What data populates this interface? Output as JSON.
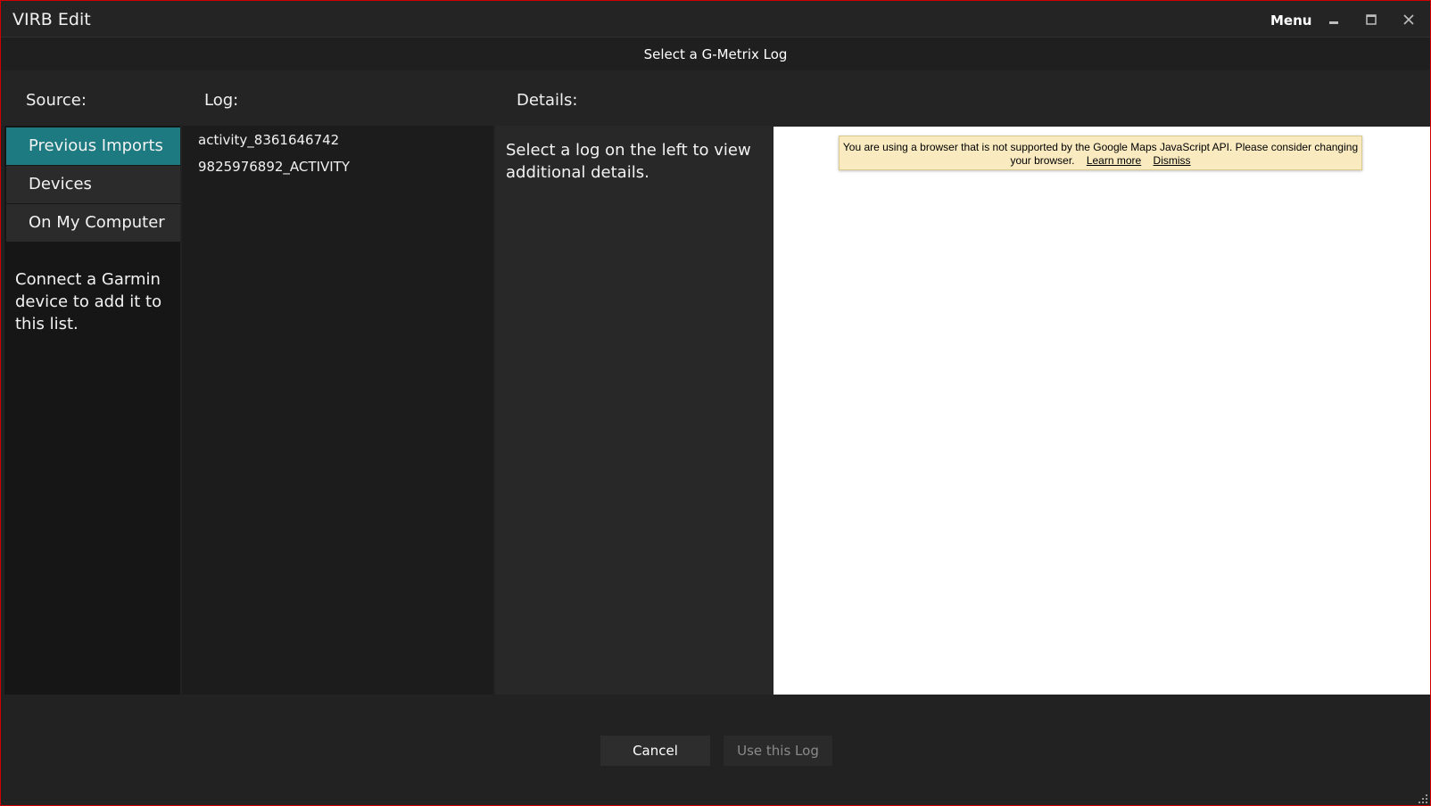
{
  "app": {
    "title": "VIRB Edit",
    "menu_label": "Menu"
  },
  "window_controls": {
    "minimize_icon": "minimize-icon",
    "maximize_icon": "maximize-icon",
    "close_icon": "close-icon"
  },
  "dialog": {
    "title": "Select a G-Metrix Log"
  },
  "columns": {
    "source": "Source:",
    "log": "Log:",
    "details": "Details:"
  },
  "sources": {
    "items": [
      {
        "label": "Previous Imports",
        "selected": true
      },
      {
        "label": "Devices",
        "selected": false
      },
      {
        "label": "On My Computer",
        "selected": false
      }
    ],
    "hint": "Connect a Garmin device to add it to this list."
  },
  "logs": {
    "items": [
      "activity_8361646742",
      "9825976892_ACTIVITY"
    ]
  },
  "details": {
    "placeholder": "Select a log on the left to view additional details."
  },
  "map": {
    "warning_text": "You are using a browser that is not supported by the Google Maps JavaScript API. Please consider changing your browser.",
    "learn_more": "Learn more",
    "dismiss": "Dismiss"
  },
  "footer": {
    "cancel_label": "Cancel",
    "use_label": "Use this Log"
  },
  "colors": {
    "accent": "#1d7a80",
    "border": "#d00000",
    "warning_bg": "#f9eac0"
  }
}
